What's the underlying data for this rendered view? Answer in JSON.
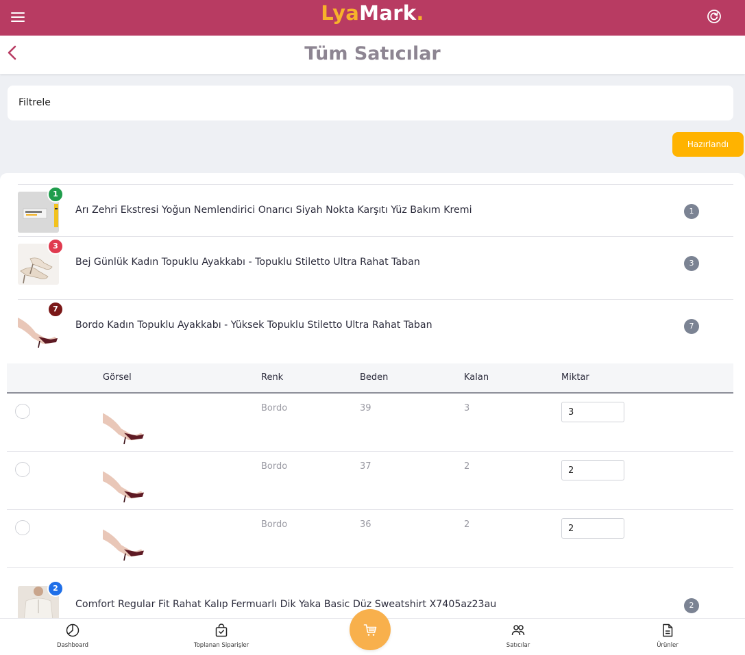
{
  "header": {
    "logo_part1": "Lya",
    "logo_part2": "Mark",
    "logo_dot": ".",
    "brand_color": "#b83b62",
    "accent_color": "#f7b22b"
  },
  "title": "Tüm Satıcılar",
  "filter": {
    "label": "Filtrele"
  },
  "ready_button": {
    "label": "Hazırlandı",
    "color": "#ffb300"
  },
  "products": [
    {
      "name": "Arı Zehri Ekstresi Yoğun Nemlendirici Onarıcı Siyah Nokta Karşıtı Yüz Bakım Kremi",
      "badge": "1",
      "badge_color": "#1f9d4c",
      "count": "1",
      "image": "cream-product-image"
    },
    {
      "name": "Bej Günlük Kadın Topuklu Ayakkabı - Topuklu Stiletto Ultra Rahat Taban",
      "badge": "3",
      "badge_color": "#e03a4f",
      "count": "3",
      "image": "beige-heels-image"
    },
    {
      "name": "Bordo Kadın Topuklu Ayakkabı - Yüksek Topuklu Stiletto Ultra Rahat Taban",
      "badge": "7",
      "badge_color": "#7a1717",
      "count": "7",
      "image": "burgundy-heels-image"
    },
    {
      "name": "Comfort Regular Fit Rahat Kalıp Fermuarlı Dik Yaka Basic Düz Sweatshirt X7405az23au",
      "badge": "2",
      "badge_color": "#1f6fe8",
      "count": "2",
      "image": "sweatshirt-image"
    }
  ],
  "variants": {
    "headers": [
      "Görsel",
      "Renk",
      "Beden",
      "Kalan",
      "Miktar"
    ],
    "rows": [
      {
        "renk": "Bordo",
        "beden": "39",
        "kalan": "3",
        "miktar": "3"
      },
      {
        "renk": "Bordo",
        "beden": "37",
        "kalan": "2",
        "miktar": "2"
      },
      {
        "renk": "Bordo",
        "beden": "36",
        "kalan": "2",
        "miktar": "2"
      }
    ]
  },
  "nav": {
    "items": [
      {
        "label": "Dashboard",
        "icon": "pie-chart-icon"
      },
      {
        "label": "Toplanan Siparişler",
        "icon": "bag-check-icon"
      },
      {
        "label": "Satıcılar",
        "icon": "people-icon"
      },
      {
        "label": "Ürünler",
        "icon": "document-icon"
      }
    ],
    "center": {
      "icon": "cart-icon",
      "color": "#f8b04c"
    }
  }
}
